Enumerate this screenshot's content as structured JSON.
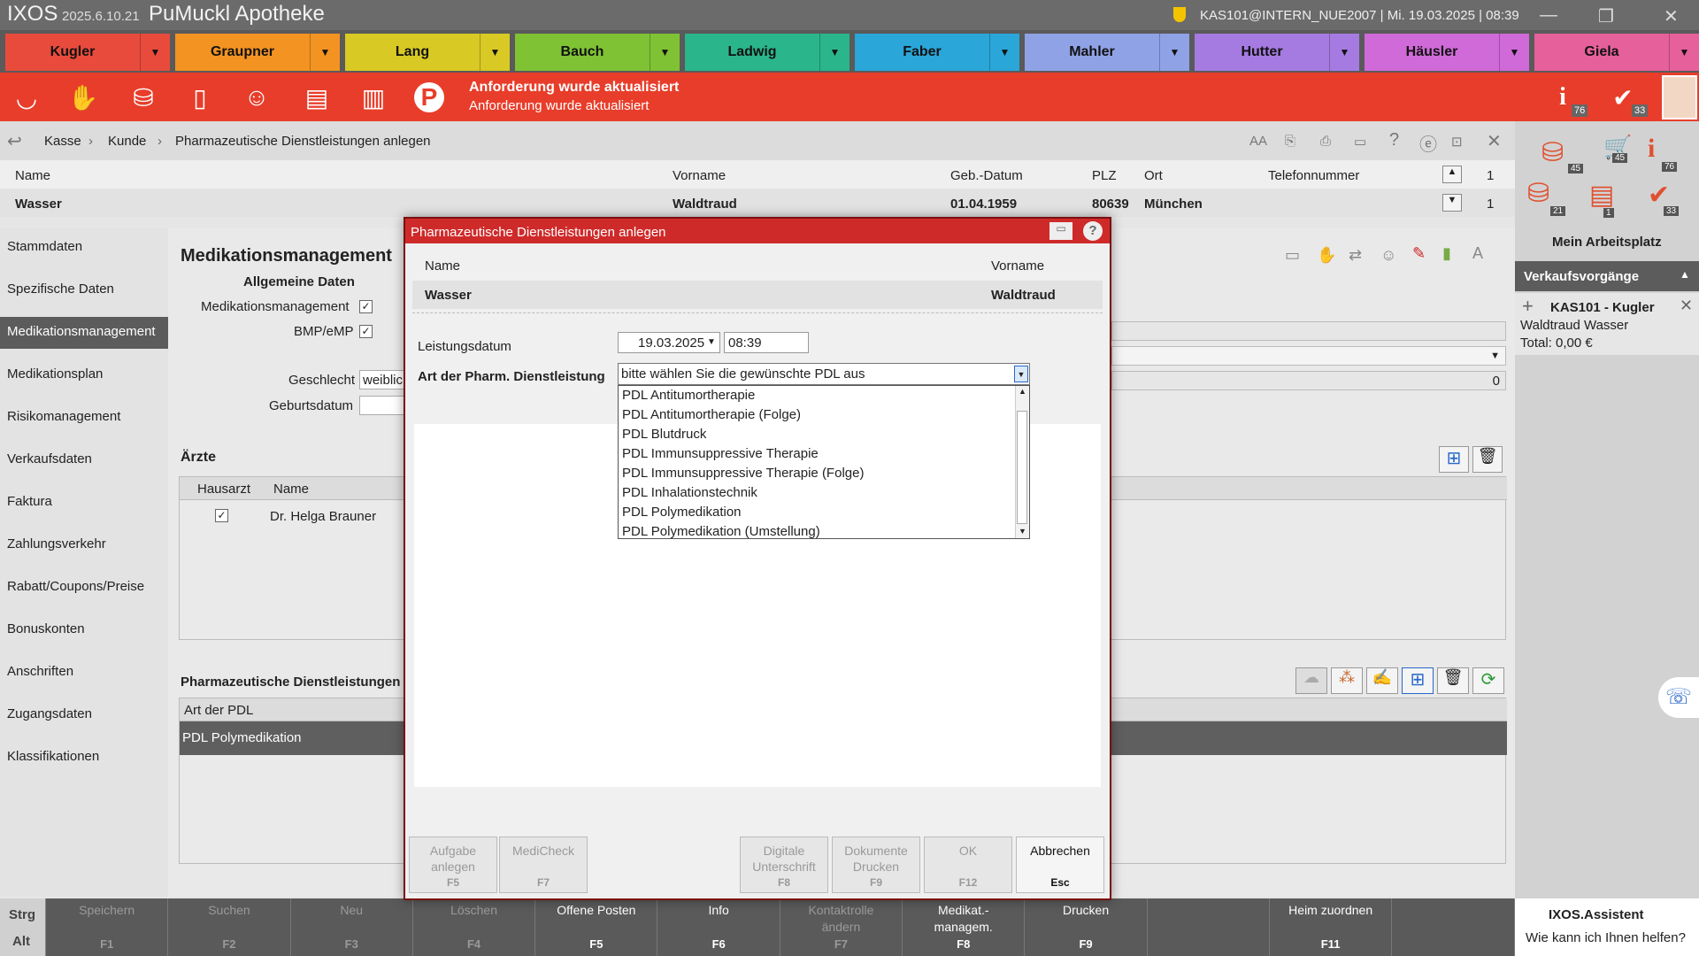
{
  "titlebar": {
    "app": "IXOS",
    "version": "2025.6.10.21",
    "pharmacy": "PuMuckl Apotheke",
    "user": "KAS101@INTERN_NUE2007  |  Mi. 19.03.2025  |  08:39"
  },
  "tabs": [
    {
      "label": "Kugler",
      "color": "#e84b3c"
    },
    {
      "label": "Graupner",
      "color": "#f39322"
    },
    {
      "label": "Lang",
      "color": "#d8c924"
    },
    {
      "label": "Bauch",
      "color": "#7fc234"
    },
    {
      "label": "Ladwig",
      "color": "#2bb58a"
    },
    {
      "label": "Faber",
      "color": "#2aa6d8"
    },
    {
      "label": "Mahler",
      "color": "#8fa2e6"
    },
    {
      "label": "Hutter",
      "color": "#a57be2"
    },
    {
      "label": "Häusler",
      "color": "#d06ad8"
    },
    {
      "label": "Giela",
      "color": "#e6609b"
    }
  ],
  "notice": {
    "title": "Anforderung wurde aktualisiert",
    "text": "Anforderung wurde aktualisiert",
    "info_count": "76",
    "task_count": "33"
  },
  "breadcrumb": [
    "Kasse",
    "Kunde",
    "Pharmazeutische Dienstleistungen anlegen"
  ],
  "customer": {
    "headers": {
      "name": "Name",
      "vorname": "Vorname",
      "geb": "Geb.-Datum",
      "plz": "PLZ",
      "ort": "Ort",
      "tel": "Telefonnummer"
    },
    "name": "Wasser",
    "vorname": "Waldtraud",
    "geb": "01.04.1959",
    "plz": "80639",
    "ort": "München",
    "page_top": "1",
    "page_bottom": "1"
  },
  "sidebar": {
    "items": [
      "Stammdaten",
      "Spezifische Daten",
      "Medikationsmanagement",
      "Medikationsplan",
      "Risikomanagement",
      "Verkaufsdaten",
      "Faktura",
      "Zahlungsverkehr",
      "Rabatt/Coupons/Preise",
      "Bonuskonten",
      "Anschriften",
      "Zugangsdaten",
      "Klassifikationen"
    ],
    "active_index": 2
  },
  "main": {
    "title": "Medikationsmanagement",
    "section": "Allgemeine Daten",
    "medmgmt_label": "Medikationsmanagement",
    "bmp_label": "BMP/eMP",
    "geschlecht_label": "Geschlecht",
    "geschlecht_value": "weiblic",
    "geburtsdatum_label": "Geburtsdatum",
    "right_value": "0",
    "aerzte_title": "Ärzte",
    "aerzte_cols": [
      "Hausarzt",
      "Name"
    ],
    "arzt_name": "Dr. Helga Brauner",
    "pdl_title": "Pharmazeutische Dienstleistungen",
    "pdl_col": "Art der PDL",
    "pdl_row": "PDL Polymedikation"
  },
  "fkeys": [
    {
      "label": "Speichern",
      "key": "F1",
      "enabled": false
    },
    {
      "label": "Suchen",
      "key": "F2",
      "enabled": false
    },
    {
      "label": "Neu",
      "key": "F3",
      "enabled": false
    },
    {
      "label": "Löschen",
      "key": "F4",
      "enabled": false
    },
    {
      "label": "Offene Posten",
      "key": "F5",
      "enabled": true
    },
    {
      "label": "Info",
      "key": "F6",
      "enabled": true
    },
    {
      "label": "Kontaktrolle ändern",
      "key": "F7",
      "enabled": false
    },
    {
      "label": "Medikat.-managem.",
      "key": "F8",
      "enabled": true
    },
    {
      "label": "Drucken",
      "key": "F9",
      "enabled": true
    },
    {
      "label": "",
      "key": "",
      "enabled": false
    },
    {
      "label": "Heim zuordnen",
      "key": "F11",
      "enabled": true
    },
    {
      "label": "",
      "key": "",
      "enabled": false
    }
  ],
  "modkeys": {
    "strg": "Strg",
    "alt": "Alt"
  },
  "rightpanel": {
    "counts": [
      "45",
      "45",
      "76",
      "21",
      "1",
      "33"
    ],
    "workspace": "Mein Arbeitsplatz",
    "sales_title": "Verkaufsvorgänge",
    "sale_title": "KAS101 - Kugler",
    "sale_customer": "Waldtraud Wasser",
    "sale_total": "Total: 0,00 €",
    "assistant_title": "IXOS.Assistent",
    "assistant_text": "Wie kann ich Ihnen helfen?"
  },
  "modal": {
    "title": "Pharmazeutische Dienstleistungen anlegen",
    "name_label": "Name",
    "vorname_label": "Vorname",
    "name": "Wasser",
    "vorname": "Waldtraud",
    "date_label": "Leistungsdatum",
    "date": "19.03.2025",
    "time": "08:39",
    "art_label": "Art der Pharm. Dienstleistung",
    "select_placeholder": "bitte wählen Sie die gewünschte PDL aus",
    "options": [
      "PDL Antitumortherapie",
      "PDL Antitumortherapie (Folge)",
      "PDL Blutdruck",
      "PDL Immunsuppressive Therapie",
      "PDL Immunsuppressive Therapie (Folge)",
      "PDL Inhalationstechnik",
      "PDL Polymedikation",
      "PDL Polymedikation (Umstellung)"
    ],
    "buttons": [
      {
        "label": "Aufgabe anlegen",
        "key": "F5",
        "enabled": false
      },
      {
        "label": "MediCheck",
        "key": "F7",
        "enabled": false
      },
      {
        "label": "Digitale Unterschrift",
        "key": "F8",
        "enabled": false
      },
      {
        "label": "Dokumente Drucken",
        "key": "F9",
        "enabled": false
      },
      {
        "label": "OK",
        "key": "F12",
        "enabled": false
      },
      {
        "label": "Abbrechen",
        "key": "Esc",
        "enabled": true
      }
    ]
  }
}
